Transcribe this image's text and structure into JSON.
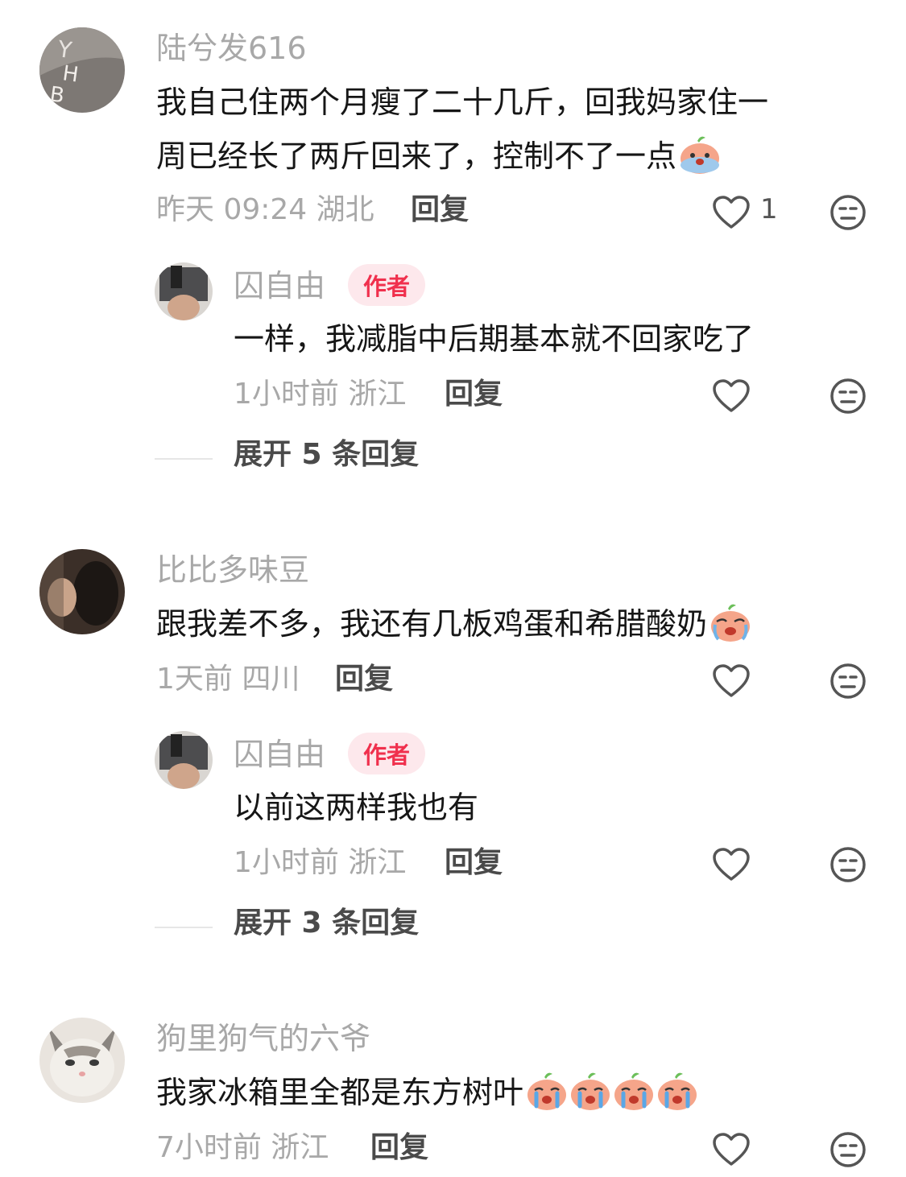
{
  "comments": [
    {
      "user": "陆兮发616",
      "text_line1": "我自己住两个月瘦了二十几斤，回我妈家住一",
      "text_line2": "周已经长了两斤回来了，控制不了一点",
      "meta": "昨天 09:24 湖北",
      "reply_label": "回复",
      "like_count": "1",
      "reply": {
        "user": "囚自由",
        "badge": "作者",
        "text": "一样，我减脂中后期基本就不回家吃了",
        "meta": "1小时前 浙江",
        "reply_label": "回复"
      },
      "expand_label": "展开 5 条回复"
    },
    {
      "user": "比比多味豆",
      "text": "跟我差不多，我还有几板鸡蛋和希腊酸奶",
      "meta": "1天前 四川",
      "reply_label": "回复",
      "reply": {
        "user": "囚自由",
        "badge": "作者",
        "text": "以前这两样我也有",
        "meta": "1小时前 浙江",
        "reply_label": "回复"
      },
      "expand_label": "展开 3 条回复"
    },
    {
      "user": "狗里狗气的六爷",
      "text": "我家冰箱里全都是东方树叶",
      "meta": "7小时前 浙江",
      "reply_label": "回复"
    }
  ],
  "icons": {
    "like": "heart-outline-icon",
    "dislike": "neutral-face-icon",
    "emoji": "crying-peach-emoji"
  },
  "colors": {
    "badge_text": "#f0304d",
    "badge_bg": "#fde8ec",
    "name_gray": "#a8a8a8"
  }
}
